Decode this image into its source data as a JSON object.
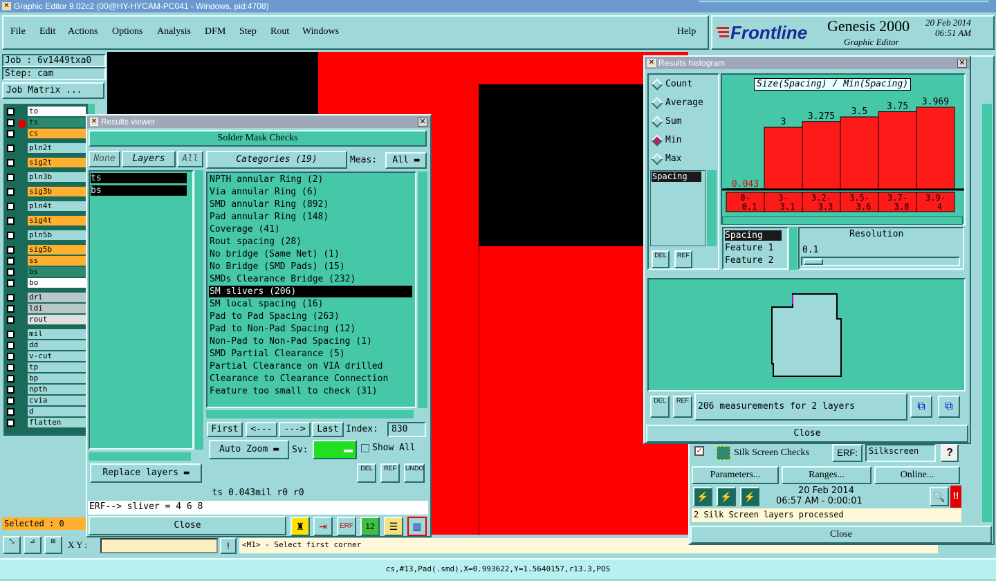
{
  "app": {
    "title": "Graphic Editor 9.02c2 (00@HY-HYCAM-PC041 - Windows, pid:4708)"
  },
  "menu": {
    "items": [
      "File",
      "Edit",
      "Actions",
      "Options",
      "Analysis",
      "DFM",
      "Step",
      "Rout",
      "Windows"
    ],
    "help": "Help"
  },
  "brand": {
    "logo": "Frontline",
    "product": "Genesis 2000",
    "subtitle": "Graphic Editor",
    "date": "20 Feb 2014",
    "time": "06:51 AM"
  },
  "job": {
    "job_label": "Job : 6v1449txa0",
    "step_label": "Step: cam",
    "matrix_button": "Job Matrix ..."
  },
  "layers": [
    {
      "name": "to",
      "bg": "#ffffff"
    },
    {
      "name": "ts",
      "bg": "#2e8a6e"
    },
    {
      "name": "cs",
      "bg": "#ffb030"
    },
    {
      "name": "pln2t",
      "bg": "#9ed8d8"
    },
    {
      "name": "sig2t",
      "bg": "#ffb030"
    },
    {
      "name": "pln3b",
      "bg": "#9ed8d8"
    },
    {
      "name": "sig3b",
      "bg": "#ffb030"
    },
    {
      "name": "pln4t",
      "bg": "#9ed8d8"
    },
    {
      "name": "sig4t",
      "bg": "#ffb030"
    },
    {
      "name": "pln5b",
      "bg": "#9ed8d8"
    },
    {
      "name": "sig5b",
      "bg": "#ffb030"
    },
    {
      "name": "ss",
      "bg": "#ffb030"
    },
    {
      "name": "bs",
      "bg": "#2e8a6e"
    },
    {
      "name": "bo",
      "bg": "#ffffff"
    },
    {
      "name": "drl",
      "bg": "#b8c8c8"
    },
    {
      "name": "ldi",
      "bg": "#b8c8c8"
    },
    {
      "name": "rout",
      "bg": "#e0e0e0"
    },
    {
      "name": "mil",
      "bg": "#9ed8d8"
    },
    {
      "name": "dd",
      "bg": "#9ed8d8"
    },
    {
      "name": "v-cut",
      "bg": "#9ed8d8"
    },
    {
      "name": "tp",
      "bg": "#9ed8d8"
    },
    {
      "name": "bp",
      "bg": "#9ed8d8"
    },
    {
      "name": "npth",
      "bg": "#9ed8d8"
    },
    {
      "name": "cvia",
      "bg": "#9ed8d8"
    },
    {
      "name": "d",
      "bg": "#9ed8d8"
    },
    {
      "name": "flatten",
      "bg": "#9ed8d8"
    }
  ],
  "selected": "Selected : 0",
  "results_viewer": {
    "title": "Results viewer",
    "header": "Solder Mask Checks",
    "none_btn": "None",
    "layers_btn": "Layers",
    "all_btn": "All",
    "layer_items": [
      "ts",
      "bs"
    ],
    "categories_btn": "Categories (19)",
    "meas_label": "Meas:",
    "meas_value": "All",
    "categories": [
      "NPTH annular Ring (2)",
      "Via annular Ring (6)",
      "SMD annular Ring (892)",
      "Pad annular Ring (148)",
      "Coverage (41)",
      "Rout spacing (28)",
      "No bridge (Same Net) (1)",
      "No Bridge (SMD Pads) (15)",
      "SMDs Clearance Bridge (232)",
      "SM slivers (206)",
      "SM local spacing (16)",
      "Pad to Pad Spacing (263)",
      "Pad to Non-Pad Spacing (12)",
      "Non-Pad to Non-Pad Spacing (1)",
      "SMD Partial Clearance (5)",
      "Partial Clearance on VIA drilled",
      "Clearance to Clearance Connection",
      "Feature too small to check (31)"
    ],
    "selected_category": "SM slivers (206)",
    "first": "First",
    "prev": "<---",
    "next": "--->",
    "last": "Last",
    "index_label": "Index:",
    "index_value": "830",
    "auto_zoom": "Auto Zoom",
    "sv_label": "Sv:",
    "show_all": "Show All",
    "replace_layers": "Replace layers",
    "del": "DEL",
    "ref": "REF",
    "undo": "UNDO",
    "status": "ts 0.043mil  r0  r0",
    "erf": "ERF--> sliver = 4 6 8",
    "close": "Close"
  },
  "histogram": {
    "title": "Results histogram",
    "options": [
      "Count",
      "Average",
      "Sum",
      "Min",
      "Max"
    ],
    "selected_option": "Min",
    "list_item": "Spacing",
    "chart_title": "Size(Spacing) / Min(Spacing)",
    "resolution_label": "Resolution",
    "resolution_value": "0.1",
    "feature_items": [
      "Spacing",
      "Feature 1",
      "Feature 2"
    ],
    "summary": "206 measurements for 2 layers",
    "del": "DEL",
    "ref": "REF",
    "close": "Close"
  },
  "chart_data": {
    "type": "bar",
    "title": "Size(Spacing) / Min(Spacing)",
    "categories": [
      "0-0.1",
      "3-3.1",
      "3.2-3.3",
      "3.5-3.6",
      "3.7-3.8",
      "3.9-4"
    ],
    "values": [
      0.043,
      3,
      3.275,
      3.5,
      3.75,
      3.969
    ],
    "labels": [
      "0.043",
      "3",
      "3.275",
      "3.5",
      "3.75",
      "3.969"
    ],
    "ylim": [
      0,
      4.2
    ],
    "bar_color": "#ff1a1a"
  },
  "silk": {
    "label": "Silk Screen Checks",
    "erf_label": "ERF:",
    "erf_value": "Silkscreen",
    "help": "?",
    "parameters": "Parameters...",
    "ranges": "Ranges...",
    "online": "Online...",
    "date": "20 Feb 2014",
    "time": "06:57 AM - 0:00:01",
    "status": "2 Silk Screen layers processed",
    "close": "Close"
  },
  "bottom": {
    "xy_label": "X Y :",
    "prompt": "<M1> - Select first corner",
    "statusbar": "cs,#13,Pad(.smd),X=0.993622,Y=1.5640157,r13.3,POS"
  }
}
